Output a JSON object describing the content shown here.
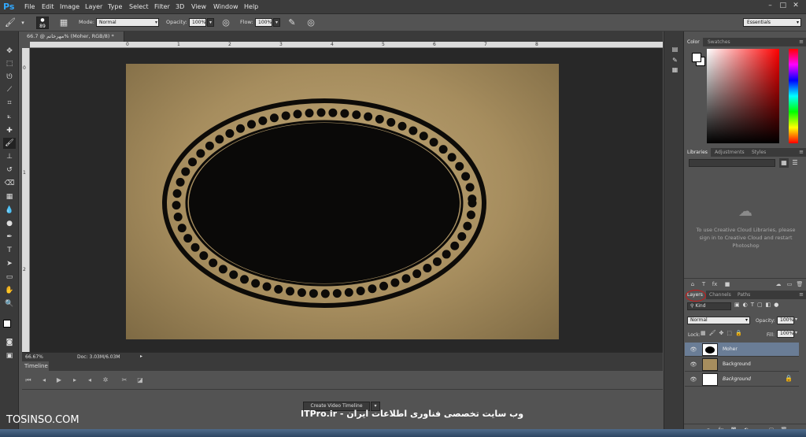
{
  "app": {
    "logo": "Ps"
  },
  "menu": [
    "File",
    "Edit",
    "Image",
    "Layer",
    "Type",
    "Select",
    "Filter",
    "3D",
    "View",
    "Window",
    "Help"
  ],
  "window_controls": [
    "–",
    "□",
    "✕"
  ],
  "options": {
    "brush_size": "89",
    "mode_label": "Mode:",
    "mode_value": "Normal",
    "opacity_label": "Opacity:",
    "opacity_value": "100%",
    "flow_label": "Flow:",
    "flow_value": "100%",
    "workspace": "Essentials"
  },
  "document": {
    "tab_title": "66.7 @ مهرخاتم% (Moher, RGB/8) *",
    "zoom": "66.67%",
    "doc_size": "Doc: 3.03M/6.03M",
    "ruler_top": [
      "0",
      "1",
      "2",
      "3",
      "4",
      "5",
      "6",
      "7",
      "8"
    ],
    "ruler_left": [
      "0",
      "1",
      "2"
    ]
  },
  "timeline": {
    "tab": "Timeline",
    "create_button": "Create Video Timeline"
  },
  "panels": {
    "color_tabs": [
      "Color",
      "Swatches"
    ],
    "library_tabs": [
      "Libraries",
      "Adjustments",
      "Styles"
    ],
    "library_message": "To use Creative Cloud Libraries, please sign in to Creative Cloud and restart Photoshop",
    "layers_tabs": [
      "Layers",
      "Channels",
      "Paths"
    ],
    "kind_filter": "Kind",
    "blend_mode": "Normal",
    "opacity_label": "Opacity:",
    "opacity_value": "100%",
    "lock_label": "Lock:",
    "fill_label": "Fill:",
    "fill_value": "100%",
    "layers": [
      {
        "name": "Moher",
        "selected": true
      },
      {
        "name": "Background",
        "selected": false
      },
      {
        "name": "Background",
        "selected": false
      }
    ]
  },
  "watermarks": {
    "left": "TOSINSO.COM",
    "center": "ITPro.ir - وب سایت تخصصی فناوری اطلاعات ایران"
  },
  "colors": {
    "accent": "#31a8ff",
    "selection": "#6a7d96",
    "highlight_circle": "#d01515"
  }
}
